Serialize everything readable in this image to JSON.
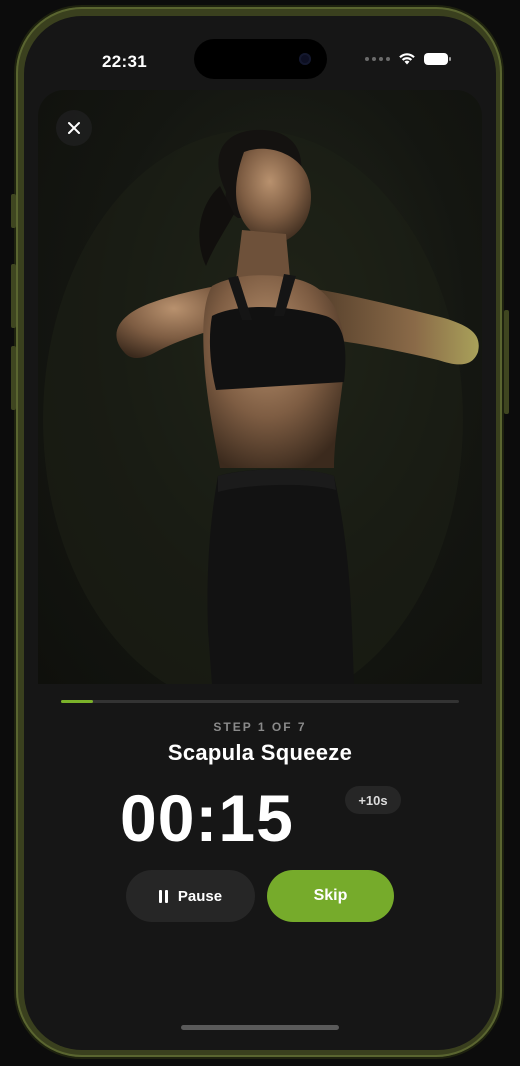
{
  "status_bar": {
    "time": "22:31",
    "icons": [
      "cellular-dots-icon",
      "wifi-icon",
      "battery-icon"
    ]
  },
  "hero": {
    "close_icon": "close-icon",
    "image": "exercise-demonstration-photo"
  },
  "workout": {
    "progress_fraction": 0.08,
    "step_label": "STEP 1 OF 7",
    "exercise_name": "Scapula Squeeze",
    "timer": "00:15",
    "add_time_label": "+10s"
  },
  "controls": {
    "pause_label": "Pause",
    "pause_icon": "pause-icon",
    "skip_label": "Skip"
  },
  "colors": {
    "accent": "#76ab2b",
    "background": "#161616",
    "frame": "#3a401e"
  }
}
